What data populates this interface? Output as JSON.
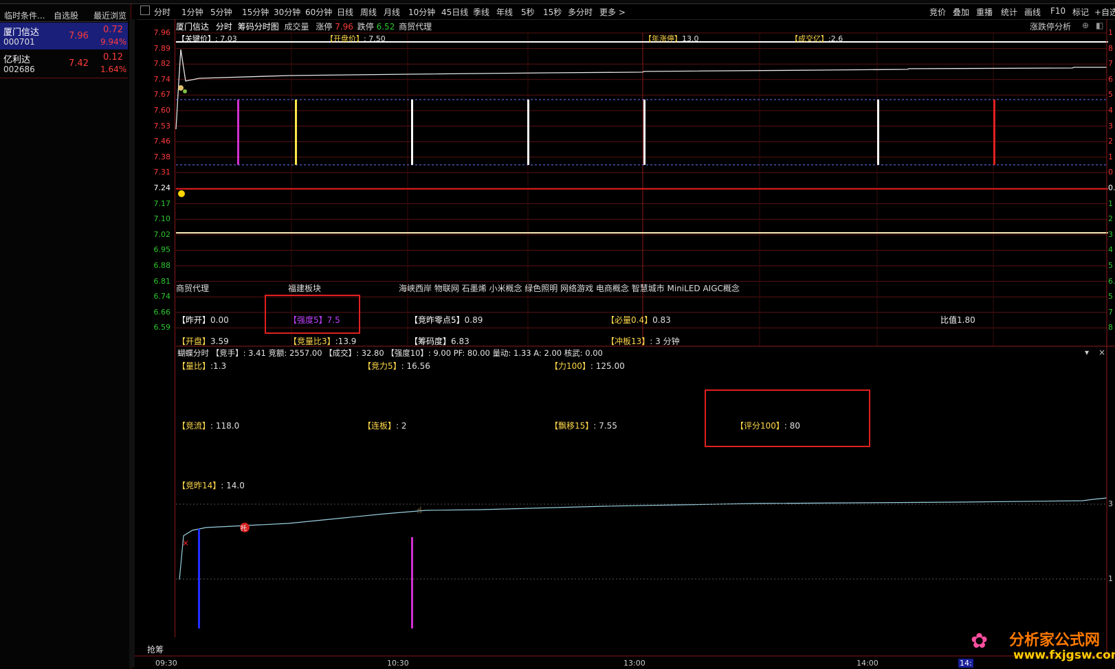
{
  "left_tabs": [
    "临时条件...",
    "自选股",
    "最近浏览"
  ],
  "stocks": [
    {
      "name": "厦门信达",
      "code": "000701",
      "price": "7.96",
      "change": "0.72",
      "pct": "9.94%"
    },
    {
      "name": "亿利达",
      "code": "002686",
      "price": "7.42",
      "change": "0.12",
      "pct": "1.64%"
    }
  ],
  "toolbar_left": [
    "分时",
    "1分钟",
    "5分钟",
    "15分钟",
    "30分钟",
    "60分钟",
    "日线",
    "周线",
    "月线",
    "10分钟",
    "45日线",
    "季线",
    "年线",
    "5秒",
    "15秒",
    "多分时",
    "更多 >"
  ],
  "toolbar_right": [
    "竞价",
    "叠加",
    "重播",
    "统计",
    "画线",
    "F10",
    "标记",
    "+自选"
  ],
  "chart_header": {
    "name": "厦门信达",
    "mode": "分时",
    "chip": "筹码分时图",
    "vol": "成交量",
    "zt_label": "涨停",
    "zt": "7.96",
    "dt_label": "跌停",
    "dt": "6.52",
    "sector": "商贸代理",
    "right": "涨跌停分析"
  },
  "y_ticks": [
    "7.96",
    "7.89",
    "7.82",
    "7.74",
    "7.67",
    "7.60",
    "7.53",
    "7.46",
    "7.38",
    "7.31",
    "7.24",
    "7.17",
    "7.10",
    "7.02",
    "6.95",
    "6.88",
    "6.81",
    "6.74",
    "6.66",
    "6.59"
  ],
  "right_ticks": [
    "1",
    "8",
    "7",
    "6",
    "5",
    "4",
    "3",
    "2",
    "1",
    "0",
    "0.",
    "1",
    "2",
    "3",
    "4",
    "5",
    "6.",
    "5",
    "7",
    "8"
  ],
  "top_labels": [
    {
      "k": "【关键价】",
      "v": ": 7.03"
    },
    {
      "k": "【开盘价】",
      "v": ": 7.50"
    },
    {
      "k": "【年涨停】",
      "v": "13.0"
    },
    {
      "k": "【成交亿】",
      "v": ":2.6"
    }
  ],
  "concept_row": {
    "a": "商贸代理",
    "b": "福建板块",
    "c": "海峡西岸 物联网 石墨烯 小米概念 绿色照明 网络游戏 电商概念 智慧城市 MiniLED AIGC概念"
  },
  "row1": [
    {
      "k": "【昨开】",
      "v": "0.00"
    },
    {
      "k": "【强度5】",
      "v": "7.5"
    },
    {
      "k": "【竞昨零点5】",
      "v": "0.89"
    },
    {
      "k": "【必量0.4】",
      "v": "0.83"
    },
    {
      "k": "比值",
      "v": "1.80"
    }
  ],
  "row2": [
    {
      "k": "【开盘】",
      "v": "3.59"
    },
    {
      "k": "【竞量比3】",
      "v": ":13.9"
    },
    {
      "k": "【筹码度】",
      "v": "6.83"
    },
    {
      "k": "【冲板13】",
      "v": ": 3 分钟"
    }
  ],
  "lower_header": "蝴蝶分时 【竞手】: 3.41 竞额: 2557.00 【成交】: 32.80 【强度10】: 9.00 PF: 80.00 量动: 1.33 A: 2.00 核武: 0.00",
  "lower_rows": [
    {
      "k": "【量比】",
      "v": ":1.3"
    },
    {
      "k": "【竞力5】",
      "v": ": 16.56"
    },
    {
      "k": "【力100】",
      "v": ": 125.00"
    },
    {
      "k": "【竞流】",
      "v": ": 118.0"
    },
    {
      "k": "【连板】",
      "v": ": 2"
    },
    {
      "k": "【飘移15】",
      "v": ": 7.55"
    },
    {
      "k": "【评分100】",
      "v": ": 80"
    },
    {
      "k": "【竞昨14】",
      "v": ": 14.0"
    }
  ],
  "qiangchou": "抢筹",
  "tuo": "托",
  "x_ticks": [
    "09:30",
    "10:30",
    "13:00",
    "14:00",
    "14:"
  ],
  "lower_right_ticks": [
    "3",
    "1"
  ],
  "watermark": {
    "cn": "分析家公式网",
    "url": "www.fxjgsw.com"
  },
  "colors": {
    "up": "#ff3b3b",
    "grid": "#5a1212",
    "label_yellow": "#ffd84a",
    "purple": "#c040ff"
  }
}
